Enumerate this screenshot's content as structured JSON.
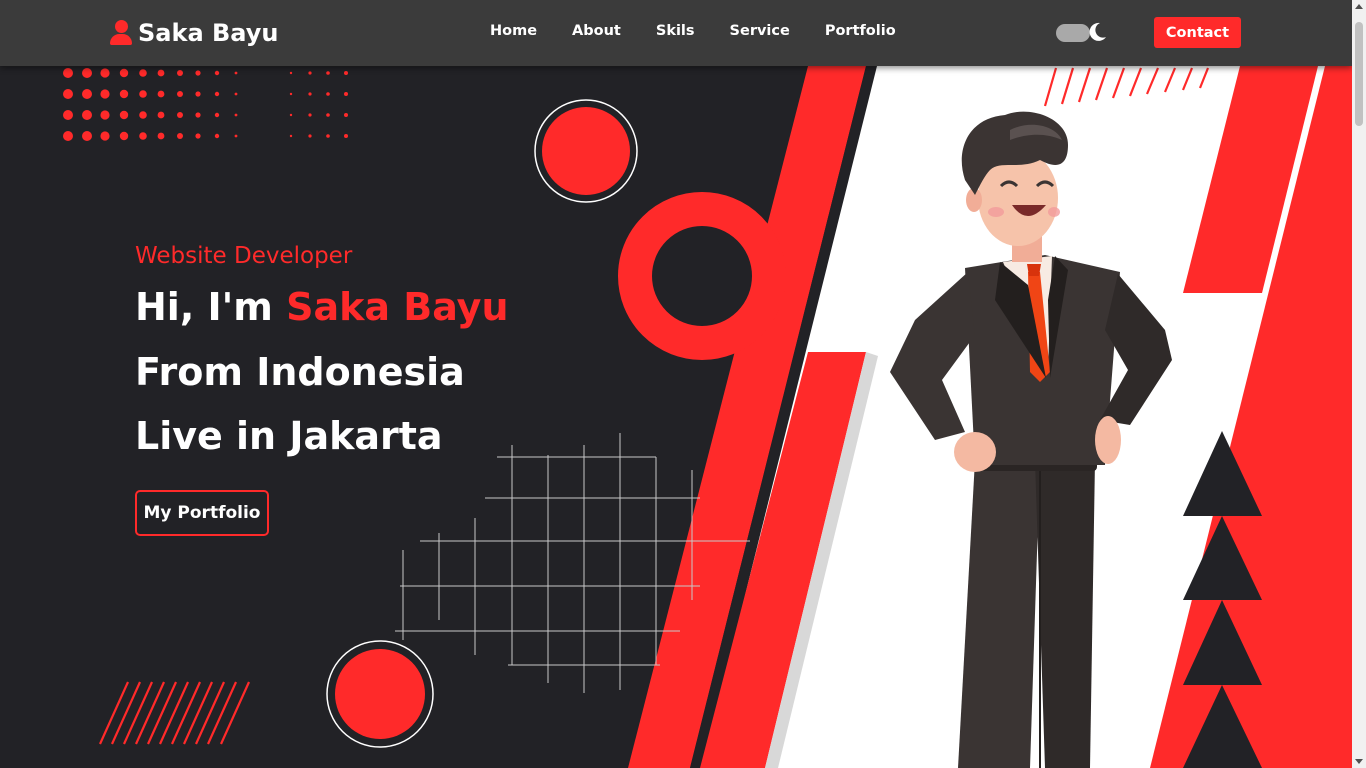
{
  "brand": {
    "name": "Saka Bayu",
    "icon": "user-icon"
  },
  "nav": {
    "links": [
      {
        "label": "Home"
      },
      {
        "label": "About"
      },
      {
        "label": "Skils"
      },
      {
        "label": "Service"
      },
      {
        "label": "Portfolio"
      }
    ],
    "theme_toggle": {
      "icon": "moon-icon"
    },
    "contact_label": "Contact"
  },
  "hero": {
    "subtitle": "Website Developer",
    "greeting": "Hi, I'm ",
    "name": "Saka Bayu",
    "line2": "From Indonesia",
    "line3": "Live in Jakarta",
    "button_label": "My Portfolio"
  },
  "colors": {
    "accent": "#ff2a2a",
    "background": "#222226",
    "navbar": "#3b3b3b",
    "panel": "#ffffff"
  }
}
